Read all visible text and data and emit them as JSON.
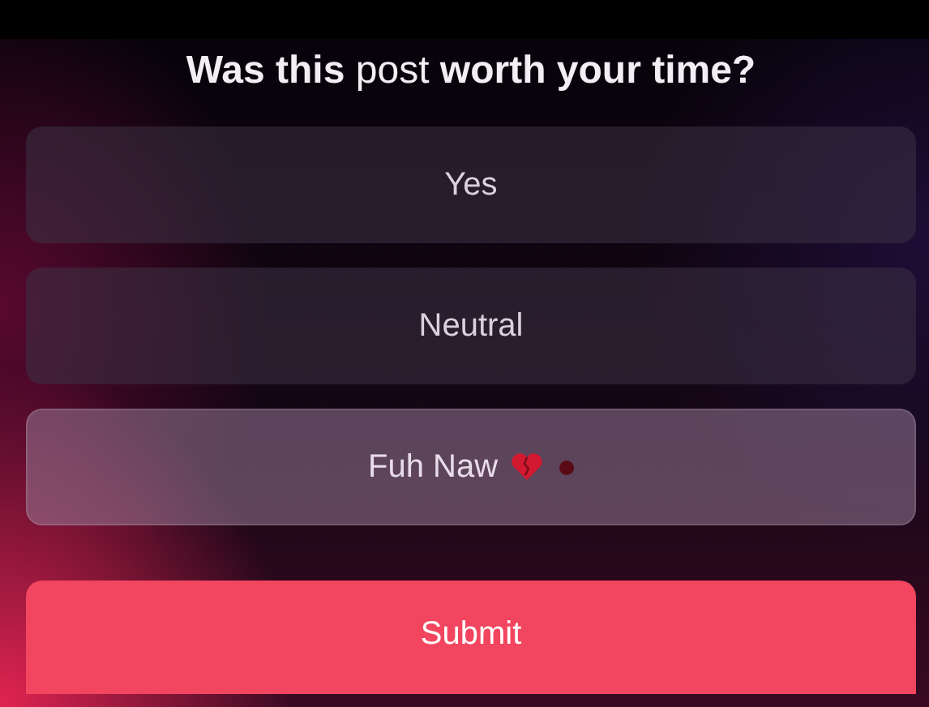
{
  "title": "**Was this** post **worth your time?**",
  "options": [
    {
      "label": "Yes",
      "selected": false,
      "kind": "plain"
    },
    {
      "label": "Neutral",
      "selected": false,
      "kind": "plain"
    },
    {
      "label": "Fuh Naw",
      "selected": true,
      "kind": "with-icons"
    }
  ],
  "submit": "Submit"
}
